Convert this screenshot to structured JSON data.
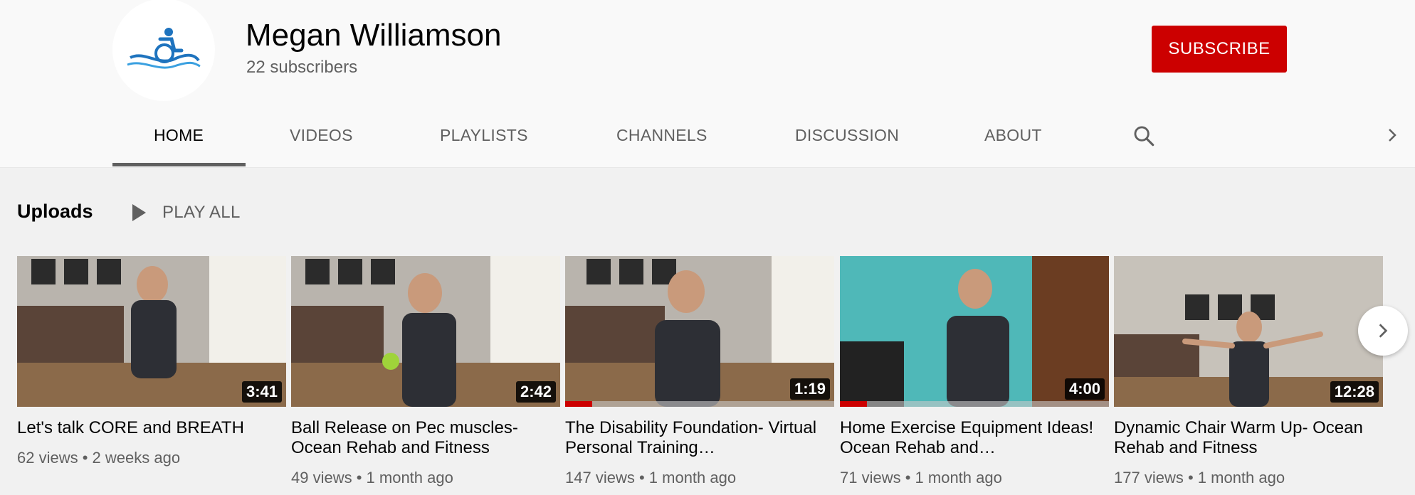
{
  "channel": {
    "name": "Megan Williamson",
    "subscribers": "22 subscribers",
    "subscribe_label": "SUBSCRIBE",
    "brand_color": "#cc0000",
    "logo_icon": "wheelchair-wave-logo"
  },
  "tabs": [
    {
      "label": "HOME",
      "active": true
    },
    {
      "label": "VIDEOS",
      "active": false
    },
    {
      "label": "PLAYLISTS",
      "active": false
    },
    {
      "label": "CHANNELS",
      "active": false
    },
    {
      "label": "DISCUSSION",
      "active": false
    },
    {
      "label": "ABOUT",
      "active": false
    }
  ],
  "uploads": {
    "title": "Uploads",
    "play_all_label": "PLAY ALL",
    "videos": [
      {
        "title": "Let's talk CORE and BREATH",
        "duration": "3:41",
        "views": "62 views",
        "age": "2 weeks ago",
        "watched_fraction": 0
      },
      {
        "title": "Ball Release on Pec muscles- Ocean Rehab and Fitness",
        "duration": "2:42",
        "views": "49 views",
        "age": "1 month ago",
        "watched_fraction": 0
      },
      {
        "title": "The Disability Foundation- Virtual Personal Training…",
        "duration": "1:19",
        "views": "147 views",
        "age": "1 month ago",
        "watched_fraction": 0.1
      },
      {
        "title": "Home Exercise Equipment Ideas! Ocean Rehab and…",
        "duration": "4:00",
        "views": "71 views",
        "age": "1 month ago",
        "watched_fraction": 0.1
      },
      {
        "title": "Dynamic Chair Warm Up- Ocean Rehab and Fitness",
        "duration": "12:28",
        "views": "177 views",
        "age": "1 month ago",
        "watched_fraction": 0
      }
    ]
  }
}
